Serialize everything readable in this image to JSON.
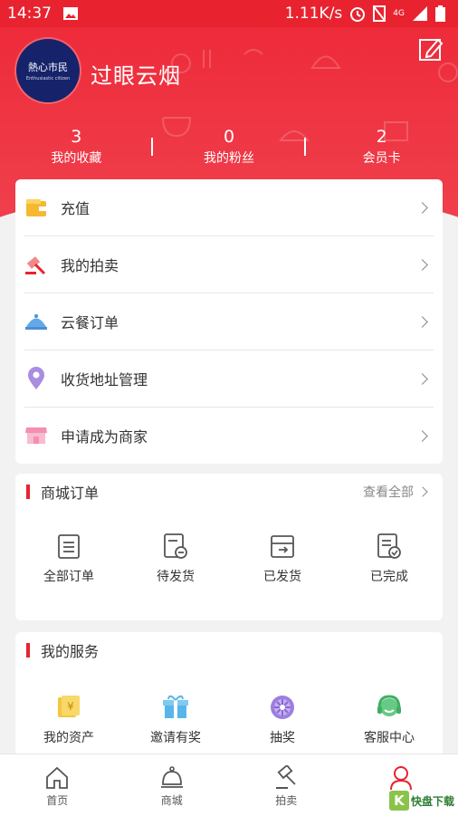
{
  "status_bar": {
    "time": "14:37",
    "speed": "1.11K/s",
    "network": "4G"
  },
  "profile": {
    "avatar_text": "熱心市民",
    "avatar_subtext": "Enthusiastic citizen",
    "name": "过眼云烟"
  },
  "stats": [
    {
      "value": "3",
      "label": "我的收藏"
    },
    {
      "value": "0",
      "label": "我的粉丝"
    },
    {
      "value": "2",
      "label": "会员卡"
    }
  ],
  "menu": [
    {
      "label": "充值",
      "icon": "wallet-icon"
    },
    {
      "label": "我的拍卖",
      "icon": "gavel-icon"
    },
    {
      "label": "云餐订单",
      "icon": "cloche-icon"
    },
    {
      "label": "收货地址管理",
      "icon": "location-pin-icon"
    },
    {
      "label": "申请成为商家",
      "icon": "store-icon"
    }
  ],
  "orders": {
    "title": "商城订单",
    "more": "查看全部",
    "items": [
      {
        "label": "全部订单",
        "icon": "clipboard-icon"
      },
      {
        "label": "待发货",
        "icon": "pending-shipment-icon"
      },
      {
        "label": "已发货",
        "icon": "shipped-box-icon"
      },
      {
        "label": "已完成",
        "icon": "completed-doc-icon"
      }
    ]
  },
  "services": {
    "title": "我的服务",
    "items": [
      {
        "label": "我的资产",
        "icon": "assets-icon"
      },
      {
        "label": "邀请有奖",
        "icon": "gift-icon"
      },
      {
        "label": "抽奖",
        "icon": "lottery-wheel-icon"
      },
      {
        "label": "客服中心",
        "icon": "headset-icon"
      }
    ]
  },
  "tabs": [
    {
      "label": "首页",
      "icon": "home-icon"
    },
    {
      "label": "商城",
      "icon": "bell-shop-icon"
    },
    {
      "label": "拍卖",
      "icon": "auction-icon"
    },
    {
      "label": "",
      "icon": "user-icon"
    }
  ],
  "watermark": {
    "letter": "K",
    "text": "快盘下载"
  },
  "colors": {
    "primary": "#e8232f",
    "background": "#f2f2f2"
  }
}
